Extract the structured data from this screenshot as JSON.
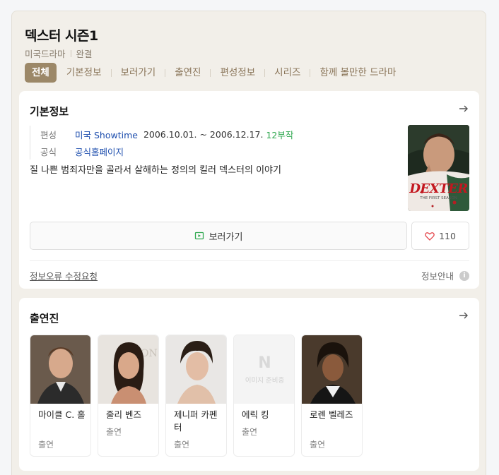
{
  "header": {
    "title": "덱스터 시즌1",
    "meta": [
      "미국드라마",
      "완결"
    ]
  },
  "tabs": [
    "전체",
    "기본정보",
    "보러가기",
    "출연진",
    "편성정보",
    "시리즈",
    "함께 볼만한 드라마"
  ],
  "basic_info": {
    "section_title": "기본정보",
    "rows": [
      {
        "label": "편성",
        "link": "미국 Showtime",
        "text": "2006.10.01. ~ 2006.12.17.",
        "highlight": "12부작"
      },
      {
        "label": "공식",
        "link": "공식홈페이지"
      }
    ],
    "synopsis": "질 나쁜 범죄자만을 골라서 살해하는 정의의 킬러 덱스터의 이야기",
    "poster_text": "DEXTER",
    "poster_subtext": "THE FIRST SEASON",
    "watch_label": "보러가기",
    "like_count": "110",
    "report_label": "정보오류 수정요청",
    "guide_label": "정보안내"
  },
  "cast_section": {
    "section_title": "출연진",
    "no_image_text": "이미지 준비중",
    "members": [
      {
        "name": "마이클 C. 홀",
        "role": "출연",
        "photo": "photo"
      },
      {
        "name": "줄리 벤즈",
        "role": "출연",
        "photo": "photo"
      },
      {
        "name": "제니퍼 카펜터",
        "role": "출연",
        "photo": "photo"
      },
      {
        "name": "에릭 킹",
        "role": "출연",
        "photo": "none"
      },
      {
        "name": "로렌 벨레즈",
        "role": "출연",
        "photo": "photo"
      }
    ]
  },
  "colors": {
    "accent_tab": "#9c8868",
    "link_blue": "#1f4fae",
    "green": "#2fa84f"
  }
}
